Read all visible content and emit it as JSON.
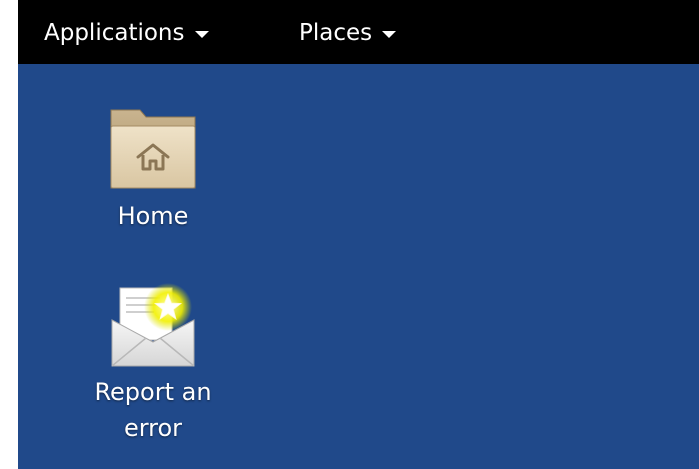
{
  "top_bar": {
    "applications_label": "Applications",
    "places_label": "Places"
  },
  "desktop": {
    "background_color": "#20498a",
    "icons": [
      {
        "label": "Home",
        "icon": "home-folder-icon"
      },
      {
        "label": "Report an error",
        "label_lines": [
          "Report an",
          "error"
        ],
        "icon": "mail-star-icon"
      }
    ]
  }
}
